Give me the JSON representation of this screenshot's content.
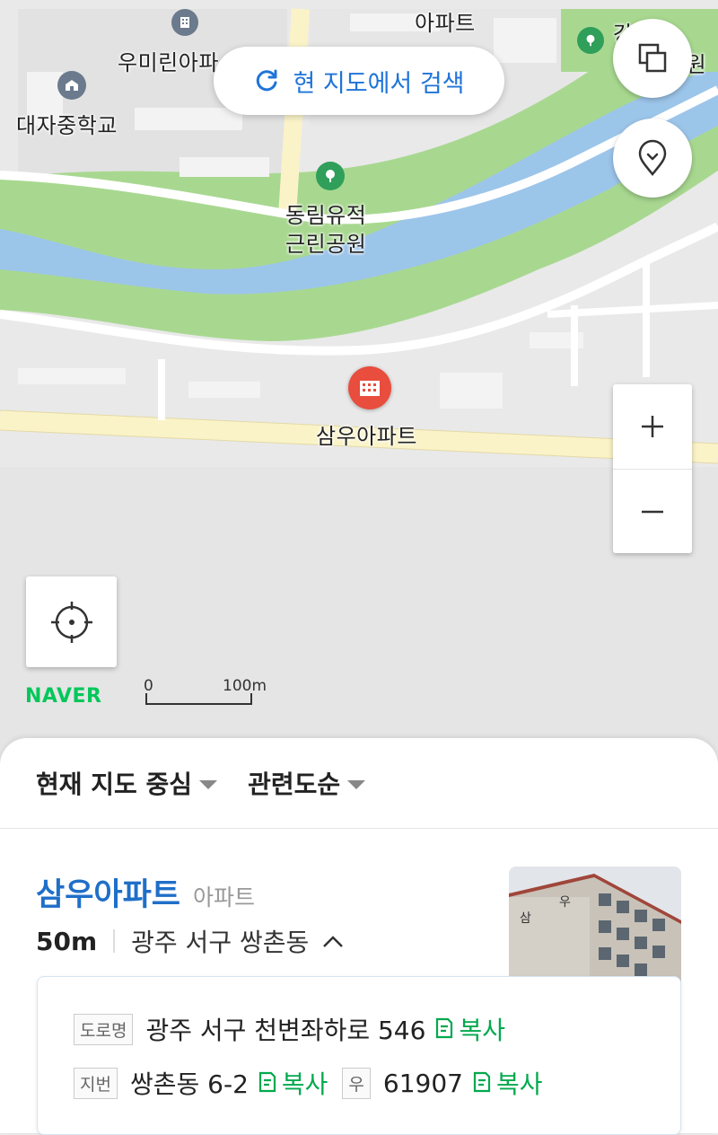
{
  "map": {
    "labels": {
      "apartment_top": "아파트",
      "umirin": "우미린아파",
      "daeja_school": "대자중학교",
      "park_line1": "동림유적",
      "park_line2": "근린공원",
      "samwoo": "삼우아파트",
      "right_top_partial_1": "강",
      "right_top_partial_2": "공원"
    },
    "search_here": "현 지도에서 검색",
    "brand": "NAVER",
    "scale": {
      "zero": "0",
      "distance": "100m"
    },
    "icons": {
      "layers": "layers-icon",
      "poi_pin": "map-pin-icon",
      "zoom_in": "plus-icon",
      "zoom_out": "minus-icon",
      "locate": "crosshair-icon",
      "refresh": "refresh-icon"
    },
    "colors": {
      "river": "#9cc5ea",
      "park": "#a8d890",
      "road": "#fbf3c8",
      "accent": "#1f74d8",
      "brand": "#03c75a",
      "poi": "#e84d3d"
    }
  },
  "sheet": {
    "filters": [
      {
        "label": "현재 지도 중심"
      },
      {
        "label": "관련도순"
      }
    ],
    "place": {
      "name": "삼우아파트",
      "category": "아파트",
      "distance": "50m",
      "region": "광주 서구 쌍촌동"
    },
    "address": {
      "road_tag": "도로명",
      "road": "광주 서구 천변좌하로 546",
      "copy_label": "복사",
      "lot_tag": "지번",
      "lot": "쌍촌동 6-2",
      "zip_tag": "우",
      "zip": "61907"
    },
    "thumb_text": [
      "삼",
      "우"
    ]
  }
}
